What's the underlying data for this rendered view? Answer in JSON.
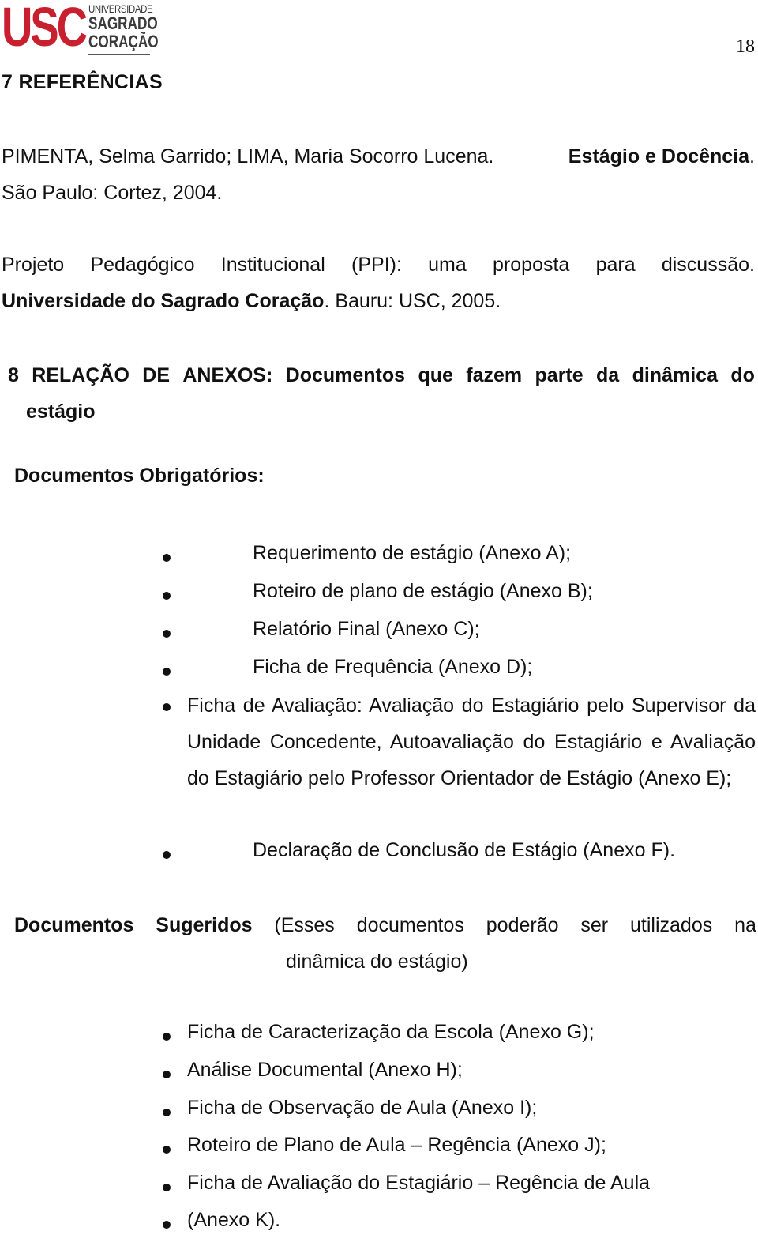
{
  "header": {
    "logo": {
      "brand_letters": "USC",
      "line1": "UNIVERSIDADE",
      "line2": "SAGRADO",
      "line3": "CORAÇÃO",
      "brand_color": "#c8202f"
    },
    "page_number": "18"
  },
  "section7": {
    "title": "7  REFERÊNCIAS",
    "references": [
      {
        "authors": "PIMENTA, Selma Garrido; LIMA, Maria Socorro Lucena.",
        "title": "Estágio e Docência",
        "after_title": ".",
        "imprint": "São Paulo: Cortez, 2004."
      },
      {
        "prefix": "Projeto Pedagógico Institucional (PPI): uma proposta para discussão.",
        "title": "Universidade do Sagrado Coração",
        "imprint": ". Bauru: USC, 2005."
      }
    ]
  },
  "section8": {
    "title_words": [
      "8",
      "RELAÇÃO",
      "DE",
      "ANEXOS:",
      "Documentos",
      "que",
      "fazem",
      "parte",
      "da",
      "dinâmica",
      "do"
    ],
    "title_line2": "estágio",
    "required": {
      "heading": "Documentos Obrigatórios:",
      "items": [
        "Requerimento de estágio (Anexo A);",
        "Roteiro de plano de estágio (Anexo B);",
        "Relatório Final (Anexo C);",
        "Ficha de Frequência (Anexo D);",
        "Ficha de Avaliação: Avaliação do Estagiário pelo Supervisor da Unidade Concedente, Autoavaliação do Estagiário e Avaliação do Estagiário pelo Professor Orientador de Estágio (Anexo E);",
        "Declaração de Conclusão de Estágio (Anexo F)."
      ]
    },
    "suggested": {
      "heading_words": [
        "Documentos",
        "Sugeridos"
      ],
      "note_words": [
        "(Esses",
        "documentos",
        "poderão",
        "ser",
        "utilizados",
        "na"
      ],
      "note_line2": "dinâmica do estágio)",
      "items": [
        "Ficha de Caracterização da Escola (Anexo G);",
        "Análise Documental (Anexo H);",
        "Ficha de Observação de Aula (Anexo I);",
        "Roteiro de Plano de Aula – Regência (Anexo J);",
        "Ficha de Avaliação do Estagiário – Regência de Aula",
        "(Anexo K)."
      ]
    }
  }
}
